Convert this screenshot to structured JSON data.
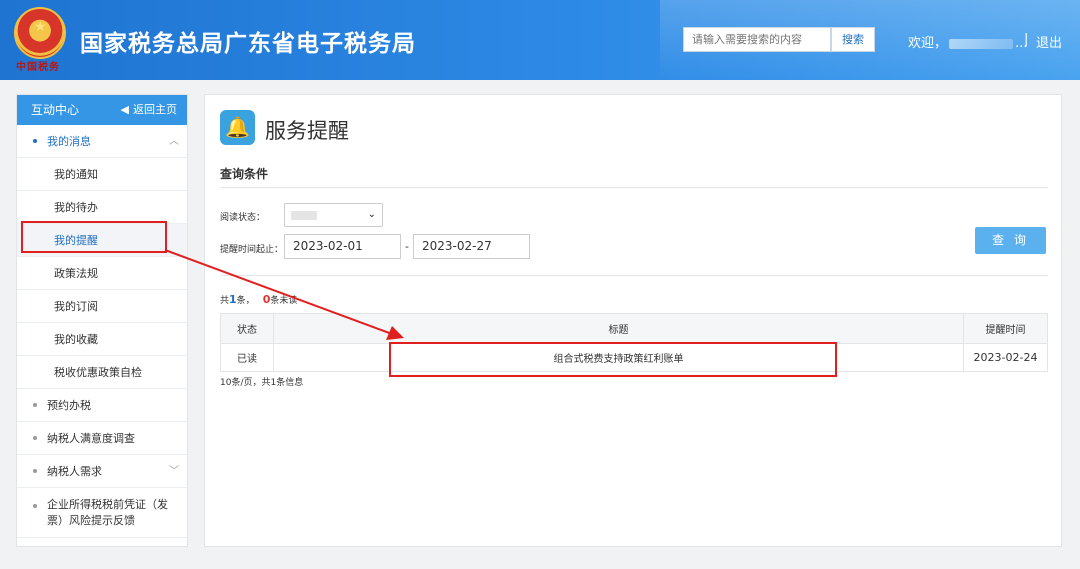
{
  "header": {
    "emblem_text": "中国税务",
    "title": "国家税务总局广东省电子税务局",
    "search_placeholder": "请输入需要搜索的内容",
    "search_button": "搜索",
    "welcome": "欢迎，",
    "welcome_tail": "...",
    "separator": "|",
    "logout": "退出"
  },
  "sidebar": {
    "head": "互动中心",
    "back": "返回主页",
    "groups": [
      {
        "label": "我的消息",
        "expanded": true,
        "children": [
          "我的通知",
          "我的待办",
          "我的提醒",
          "政策法规",
          "我的订阅",
          "我的收藏",
          "税收优惠政策自检"
        ],
        "active_child": "我的提醒"
      },
      {
        "label": "预约办税"
      },
      {
        "label": "纳税人满意度调查"
      },
      {
        "label": "纳税人需求"
      },
      {
        "label": "企业所得税税前凭证（发票）风险提示反馈"
      }
    ]
  },
  "main": {
    "page_title": "服务提醒",
    "section_title": "查询条件",
    "read_status_label": "阅读状态：",
    "date_label": "提醒时间起止：",
    "date_start": "2023-02-01",
    "date_sep": "-",
    "date_end": "2023-02-27",
    "query_button": "查 询",
    "count": {
      "prefix": "共",
      "total": "1",
      "mid": "条，",
      "unread": "0",
      "suffix": "条未读"
    },
    "table": {
      "headers": [
        "状态",
        "标题",
        "提醒时间"
      ],
      "rows": [
        {
          "status": "已读",
          "title": "组合式税费支持政策红利账单",
          "time": "2023-02-24"
        }
      ]
    },
    "pager": "10条/页，共1条信息"
  },
  "colors": {
    "header_blue": "#1f74d1",
    "sidebar_head": "#3596e6",
    "button_blue": "#5bb1ee",
    "annotation_red": "#e01f1f"
  }
}
